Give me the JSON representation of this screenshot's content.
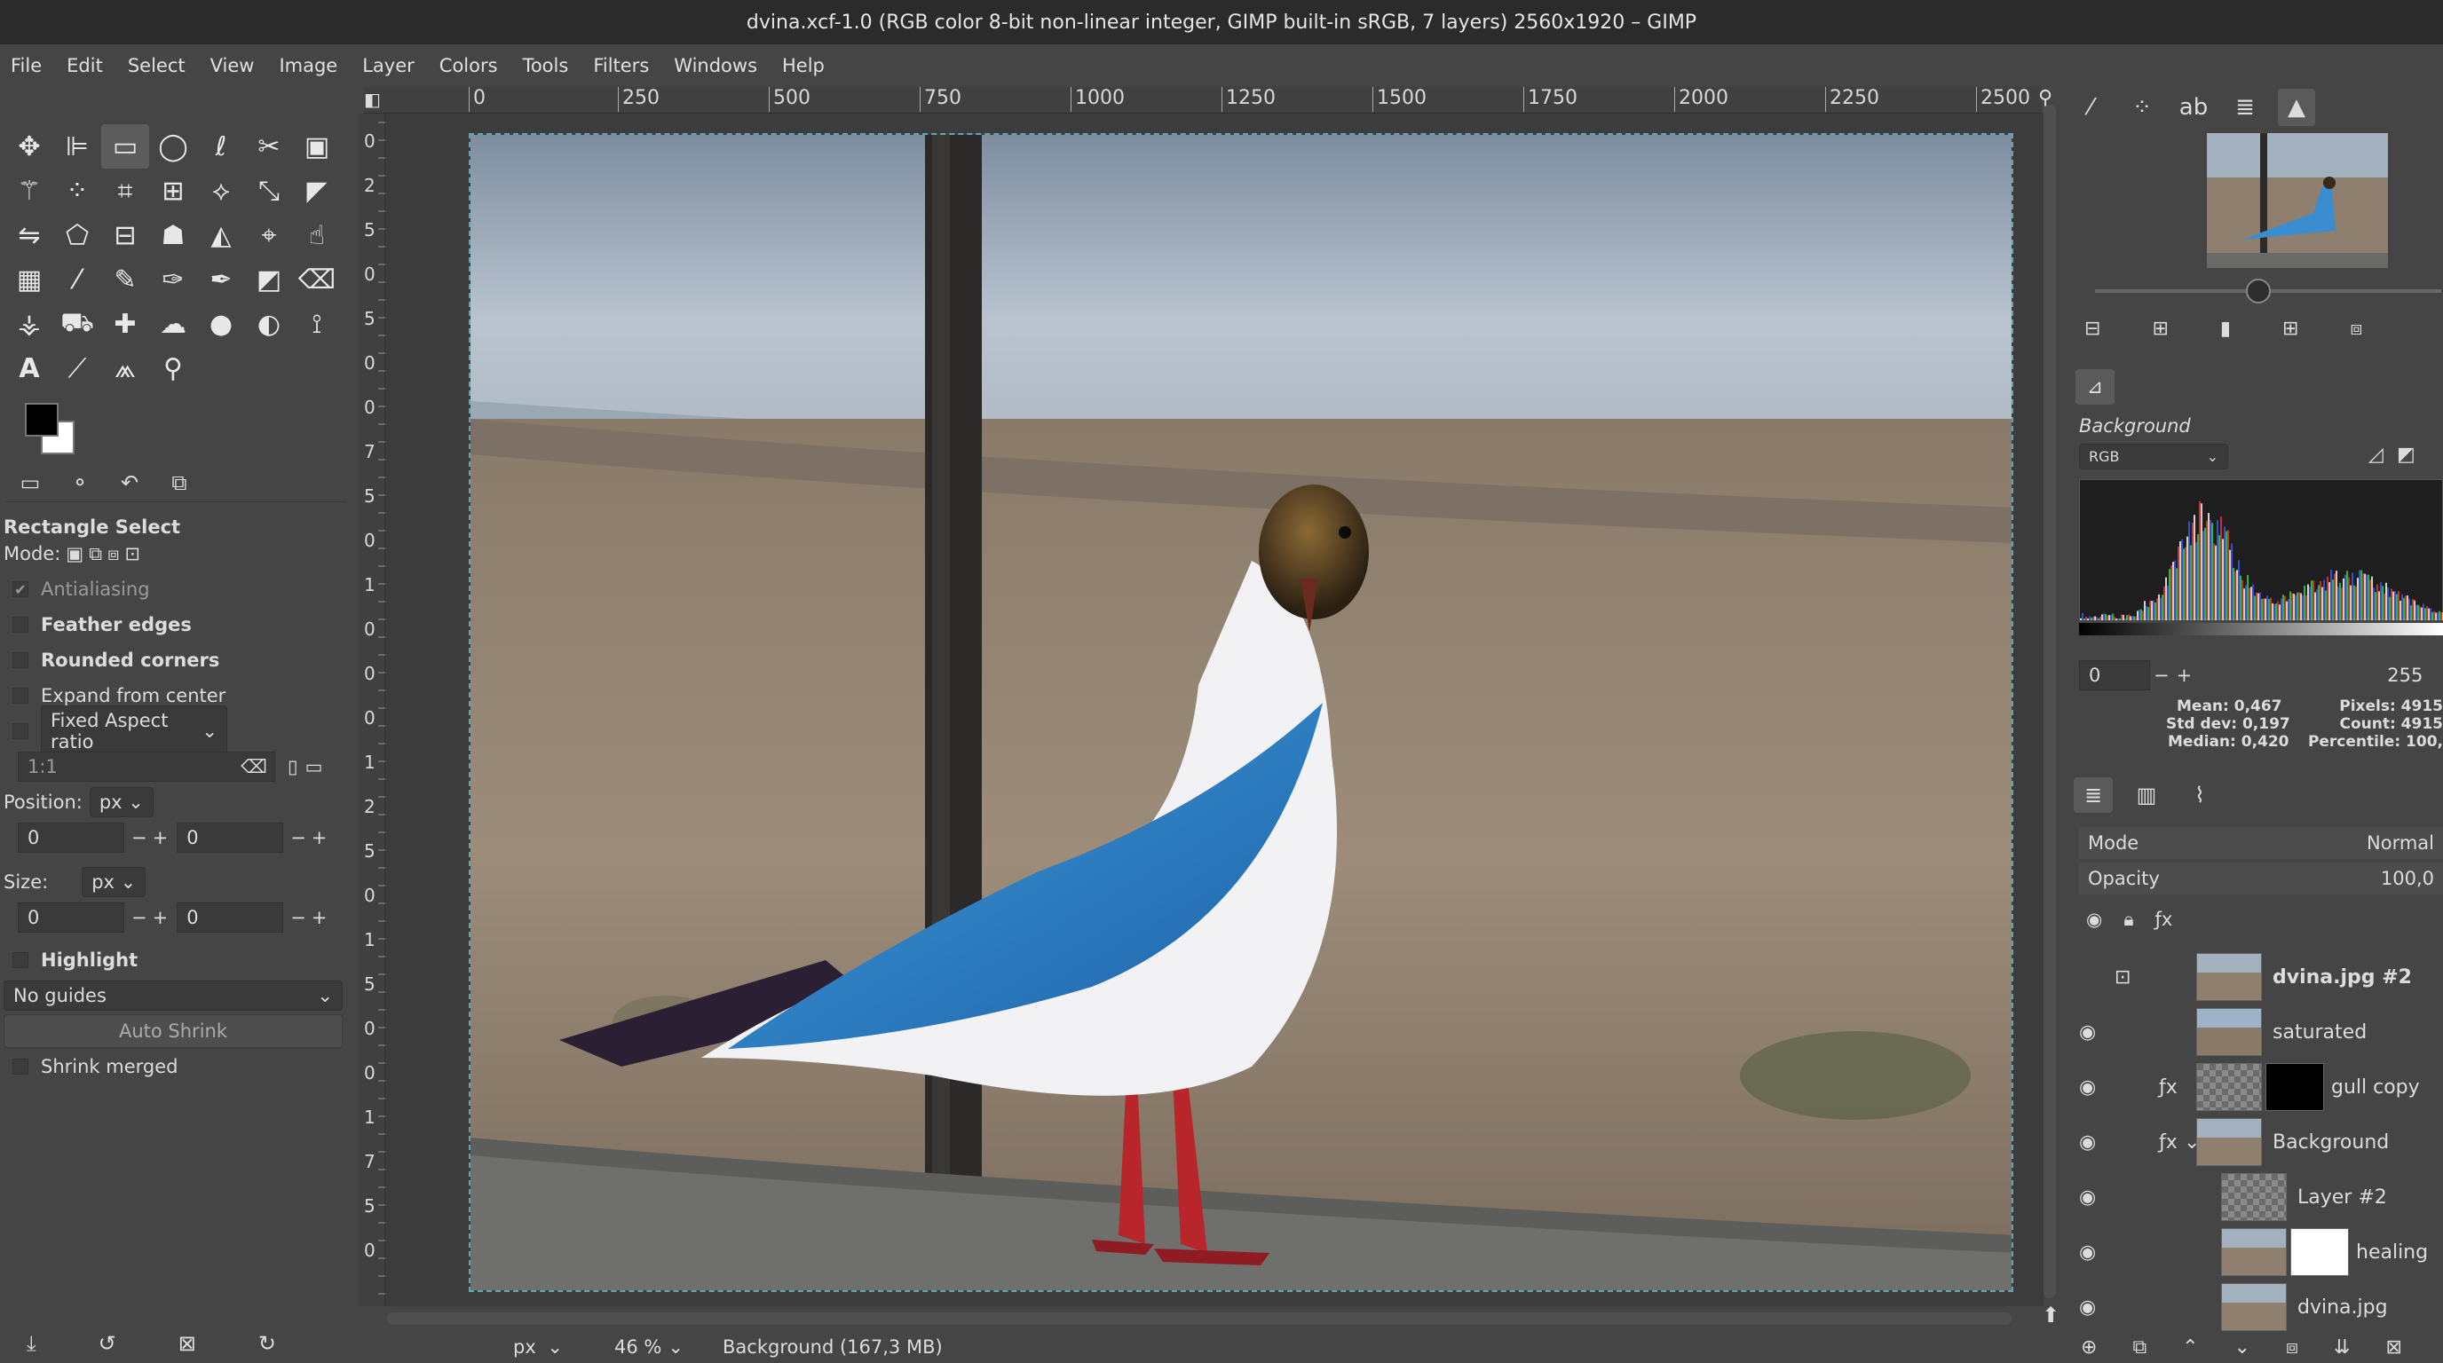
{
  "window": {
    "title": "dvina.xcf-1.0 (RGB color 8-bit non-linear integer, GIMP built-in sRGB, 7 layers) 2560x1920 – GIMP"
  },
  "menu": [
    "File",
    "Edit",
    "Select",
    "View",
    "Image",
    "Layer",
    "Colors",
    "Tools",
    "Filters",
    "Windows",
    "Help"
  ],
  "tool_options": {
    "title": "Rectangle Select",
    "mode_label": "Mode:",
    "antialiasing": "Antialiasing",
    "feather": "Feather edges",
    "rounded": "Rounded corners",
    "expand": "Expand from center",
    "fixed": "Fixed Aspect ratio",
    "ratio_value": "1:1",
    "position_label": "Position:",
    "position_unit": "px",
    "pos_x": "0",
    "pos_y": "0",
    "size_label": "Size:",
    "size_unit": "px",
    "size_w": "0",
    "size_h": "0",
    "highlight": "Highlight",
    "guides": "No guides",
    "auto_shrink": "Auto Shrink",
    "shrink_merged": "Shrink merged"
  },
  "ruler_labels": [
    "0",
    "250",
    "500",
    "750",
    "1000",
    "1250",
    "1500",
    "1750",
    "2000",
    "2250",
    "2500"
  ],
  "vruler_labels": [
    "0",
    "2",
    "5",
    "0",
    "5",
    "0",
    "0",
    "7",
    "5",
    "0",
    "1",
    "0",
    "0",
    "0",
    "1",
    "2",
    "5",
    "0",
    "1",
    "5",
    "0",
    "0",
    "1",
    "7",
    "5",
    "0"
  ],
  "status": {
    "unit": "px",
    "zoom": "46 %",
    "message": "Background (167,3 MB)"
  },
  "histogram": {
    "layer": "Background",
    "channel": "RGB",
    "range_low": "0",
    "range_high": "255",
    "mean": "Mean: 0,467",
    "std": "Std dev: 0,197",
    "median": "Median: 0,420",
    "pixels": "Pixels: 4915",
    "count": "Count: 4915",
    "percentile": "Percentile: 100,"
  },
  "layers_panel": {
    "mode_label": "Mode",
    "mode_value": "Normal",
    "opacity_label": "Opacity",
    "opacity_value": "100,0",
    "layers": [
      {
        "name": "dvina.jpg #2"
      },
      {
        "name": "saturated"
      },
      {
        "name": "gull copy"
      },
      {
        "name": "Background"
      },
      {
        "name": "Layer #2"
      },
      {
        "name": "healing"
      },
      {
        "name": "dvina.jpg"
      }
    ]
  }
}
